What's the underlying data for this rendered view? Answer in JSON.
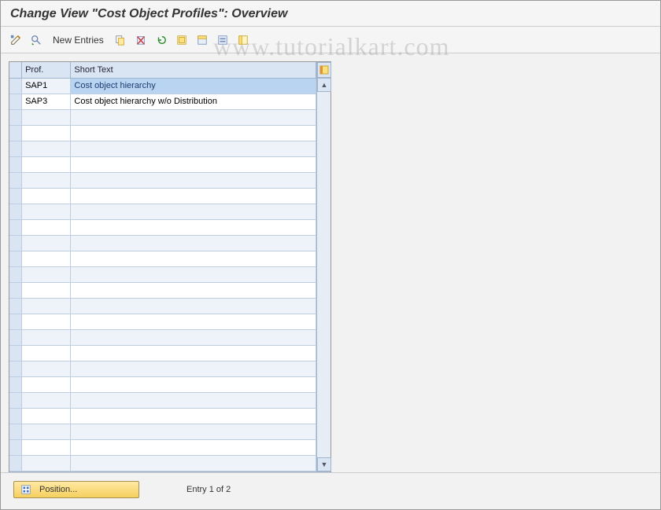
{
  "title": "Change View \"Cost Object Profiles\": Overview",
  "watermark": "www.tutorialkart.com",
  "toolbar": {
    "new_entries_label": "New Entries"
  },
  "table": {
    "col_profile": "Prof.",
    "col_short_text": "Short Text",
    "rows": [
      {
        "prof": "SAP1",
        "text": "Cost object hierarchy",
        "highlight": true
      },
      {
        "prof": "SAP3",
        "text": "Cost object hierarchy w/o Distribution",
        "highlight": false
      }
    ],
    "empty_rows": 23
  },
  "footer": {
    "position_label": "Position...",
    "entry_text": "Entry 1 of 2"
  }
}
